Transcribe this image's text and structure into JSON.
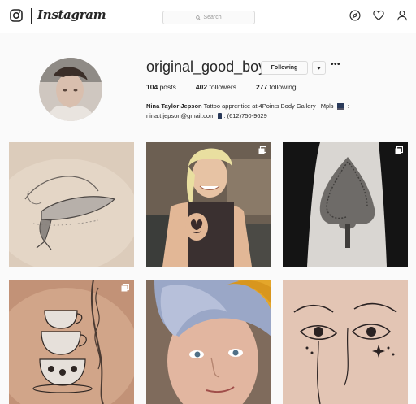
{
  "app": {
    "wordmark": "Instagram"
  },
  "search": {
    "placeholder": "Search"
  },
  "nav": {
    "icons": [
      "compass-icon",
      "heart-icon",
      "user-icon"
    ]
  },
  "profile": {
    "username": "original_good_boy",
    "follow_label": "Following",
    "more_label": "•••",
    "stats": [
      {
        "count": "104",
        "label": "posts"
      },
      {
        "count": "402",
        "label": "followers"
      },
      {
        "count": "277",
        "label": "following"
      }
    ],
    "bio": {
      "name": "Nina Taylor Jepson",
      "text_line1": " Tattoo apprentice at 4Points Body Gallery | Mpls ",
      "after_emoji1": " :",
      "text_line2_start": "nina.t.jepson@gmail.com ",
      "after_emoji2": ": (612)750-9629"
    }
  },
  "posts": [
    {
      "subject": "whale tattoo",
      "multi": false
    },
    {
      "subject": "woman with butterfly tattoo",
      "multi": true
    },
    {
      "subject": "tree tattoo",
      "multi": true
    },
    {
      "subject": "teacups tattoo",
      "multi": true
    },
    {
      "subject": "person with blue hair",
      "multi": false
    },
    {
      "subject": "face line drawing",
      "multi": false
    }
  ],
  "colors": {
    "border": "#dbdbdb",
    "background": "#fafafa",
    "text": "#262626"
  }
}
